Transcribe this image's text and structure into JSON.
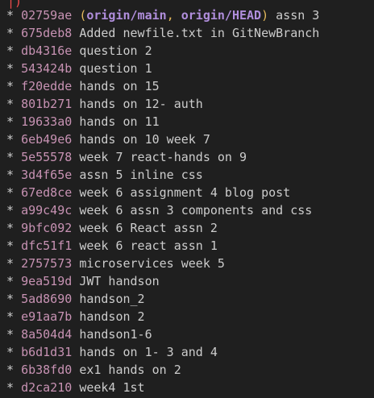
{
  "terminal": {
    "top_partial": "|)",
    "refs": {
      "open": "(",
      "main": "origin/main",
      "sep": ", ",
      "head": "origin/HEAD",
      "close": ")"
    },
    "commits": [
      {
        "star": "*",
        "hash": "02759ae",
        "message": "assn 3"
      },
      {
        "star": "*",
        "hash": "675deb8",
        "message": "Added newfile.txt in GitNewBranch"
      },
      {
        "star": "*",
        "hash": "db4316e",
        "message": "question 2"
      },
      {
        "star": "*",
        "hash": "543424b",
        "message": "question 1"
      },
      {
        "star": "*",
        "hash": "f20edde",
        "message": "hands on 15"
      },
      {
        "star": "*",
        "hash": "801b271",
        "message": "hands on 12- auth"
      },
      {
        "star": "*",
        "hash": "19633a0",
        "message": "hands on 11"
      },
      {
        "star": "*",
        "hash": "6eb49e6",
        "message": "hands on 10 week 7"
      },
      {
        "star": "*",
        "hash": "5e55578",
        "message": "week 7 react-hands on 9"
      },
      {
        "star": "*",
        "hash": "3d4f65e",
        "message": "assn 5 inline css"
      },
      {
        "star": "*",
        "hash": "67ed8ce",
        "message": "week 6 assignment 4 blog post"
      },
      {
        "star": "*",
        "hash": "a99c49c",
        "message": "week 6 assn 3 components and css"
      },
      {
        "star": "*",
        "hash": "9bfc092",
        "message": "week 6 React assn 2"
      },
      {
        "star": "*",
        "hash": "dfc51f1",
        "message": "week 6 react assn 1"
      },
      {
        "star": "*",
        "hash": "2757573",
        "message": "microservices week 5"
      },
      {
        "star": "*",
        "hash": "9ea519d",
        "message": "JWT handson"
      },
      {
        "star": "*",
        "hash": "5ad8690",
        "message": "handson_2"
      },
      {
        "star": "*",
        "hash": "e91aa7b",
        "message": "handson 2"
      },
      {
        "star": "*",
        "hash": "8a504d4",
        "message": "handson1-6"
      },
      {
        "star": "*",
        "hash": "b6d1d31",
        "message": "hands on 1- 3 and 4"
      },
      {
        "star": "*",
        "hash": "6b38fd0",
        "message": "ex1 hands on 2"
      },
      {
        "star": "*",
        "hash": "d2ca210",
        "message": "week4 1st"
      }
    ]
  },
  "colors": {
    "background": "#1f1f1f",
    "hash": "#c792b3",
    "refs_paren": "#e5b95c",
    "refs_text": "#b08edc",
    "text": "#cccccc",
    "top_partial": "#f14c4c"
  }
}
